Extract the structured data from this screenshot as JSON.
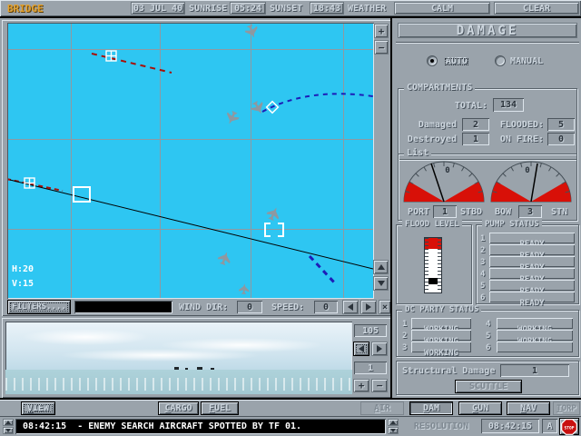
{
  "top_bar": {
    "screen_label": "BRIDGE",
    "date": "03 JUL 40",
    "sunrise_label": "SUNRISE",
    "sunrise_time": "05:24",
    "sunset_label": "SUNSET",
    "sunset_time": "18:43",
    "weather_label": "WEATHER",
    "sea_state": "CALM",
    "sky_state": "CLEAR"
  },
  "map": {
    "h_coord": "H:20",
    "v_coord": "V:15",
    "filters_button": "FILTERS....",
    "wind_dir_label": "WIND DIR:",
    "wind_dir_value": "0",
    "speed_label": "SPEED:",
    "speed_value": "0",
    "icons": {
      "zoom_in": "+",
      "zoom_out": "−",
      "close": "×"
    }
  },
  "view_3d": {
    "bearing_value": "105",
    "zoom_value": "1",
    "icons": {
      "zoom_in": "+",
      "zoom_out": "−"
    }
  },
  "damage_panel": {
    "title": "DAMAGE",
    "auto_label": "AUTO",
    "manual_label": "MANUAL",
    "compartments": {
      "label": "COMPARTMENTS",
      "total_label": "TOTAL:",
      "total_value": "134",
      "damaged_label": "Damaged",
      "damaged_value": "2",
      "flooded_label": "FLOODED:",
      "flooded_value": "5",
      "destroyed_label": "Destroyed",
      "destroyed_value": "1",
      "on_fire_label": "ON FIRE:",
      "on_fire_value": "0"
    },
    "list": {
      "label": "List",
      "gauge_zero": "0",
      "port_label": "PORT",
      "port_value": "1",
      "stbd_label": "STBD",
      "bow_label": "BOW",
      "bow_value": "3",
      "stn_label": "STN"
    },
    "flood": {
      "label": "FLOOD LEVEL"
    },
    "pumps": {
      "label": "PUMP STATUS",
      "rows": [
        {
          "num": "1",
          "status": "READY"
        },
        {
          "num": "2",
          "status": "READY"
        },
        {
          "num": "3",
          "status": "READY"
        },
        {
          "num": "4",
          "status": "READY"
        },
        {
          "num": "5",
          "status": "READY"
        },
        {
          "num": "6",
          "status": "READY"
        }
      ]
    },
    "dc_party": {
      "label": "DC PARTY STATUS",
      "rows": [
        {
          "num": "1",
          "status": "WORKING"
        },
        {
          "num": "2",
          "status": "WORKING"
        },
        {
          "num": "3",
          "status": "WORKING"
        },
        {
          "num": "4",
          "status": "WORKING"
        },
        {
          "num": "5",
          "status": "WORKING"
        },
        {
          "num": "6",
          "status": ""
        }
      ]
    },
    "structural": {
      "label": "Structural Damage",
      "value": "1"
    },
    "scuttle_button": "SCUTTLE"
  },
  "bottom_bar": {
    "view_key": "V",
    "view_rest": "IEW",
    "cargo_key": "C",
    "cargo_rest": "ARGO",
    "fuel_key": "F",
    "fuel_rest": "UEL",
    "air_key": "A",
    "air_rest": "IR",
    "dam_key": "D",
    "dam_rest": "AM",
    "gun_key": "G",
    "gun_rest": "UN",
    "nav_key": "N",
    "nav_rest": "AV",
    "torp_key": "T",
    "torp_rest": "ORP"
  },
  "message_bar": {
    "message": "08:42:15  - ENEMY SEARCH AIRCRAFT SPOTTED BY TF 01.",
    "resolution_label": "RESOLUTION",
    "clock": "08:42:15",
    "mode": "A",
    "stop_label": "STOP"
  },
  "colors": {
    "panel_gray": "#9aa3ab",
    "map_cyan": "#2ec6f2",
    "alert_red": "#d81008",
    "track_red": "#a81008",
    "track_blue": "#1d1db8",
    "bridge_orange": "#e4a22e"
  }
}
